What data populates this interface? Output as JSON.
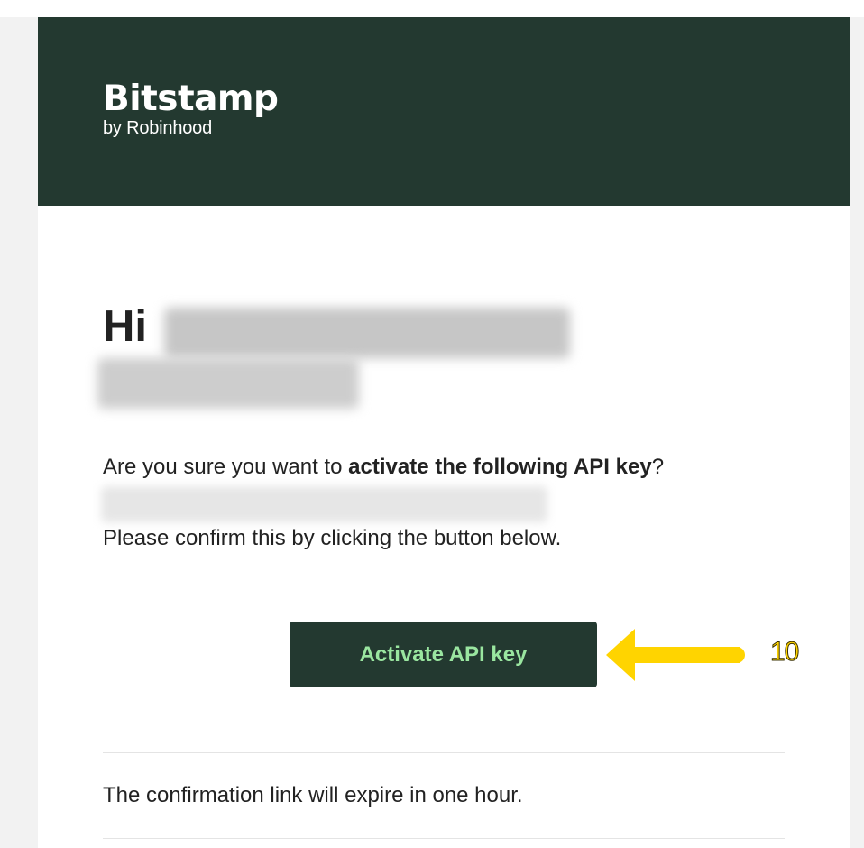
{
  "header": {
    "logo_wordmark": "Bitstamp",
    "logo_subtitle": "by Robinhood",
    "background_color": "#233930"
  },
  "greeting": {
    "salutation": "Hi"
  },
  "message": {
    "question_prefix": "Are you sure you want to ",
    "question_emphasis": "activate the following API key",
    "question_suffix": "?",
    "confirm_instruction": "Please confirm this by clicking the button below."
  },
  "action": {
    "activate_label": "Activate API key",
    "button_color": "#233930",
    "label_color": "#9ae6a0"
  },
  "footer": {
    "expiry_note": "The confirmation link will expire in one hour."
  },
  "annotation": {
    "step_number": "10",
    "color": "#ffd400",
    "icon": "arrow-left-icon"
  }
}
